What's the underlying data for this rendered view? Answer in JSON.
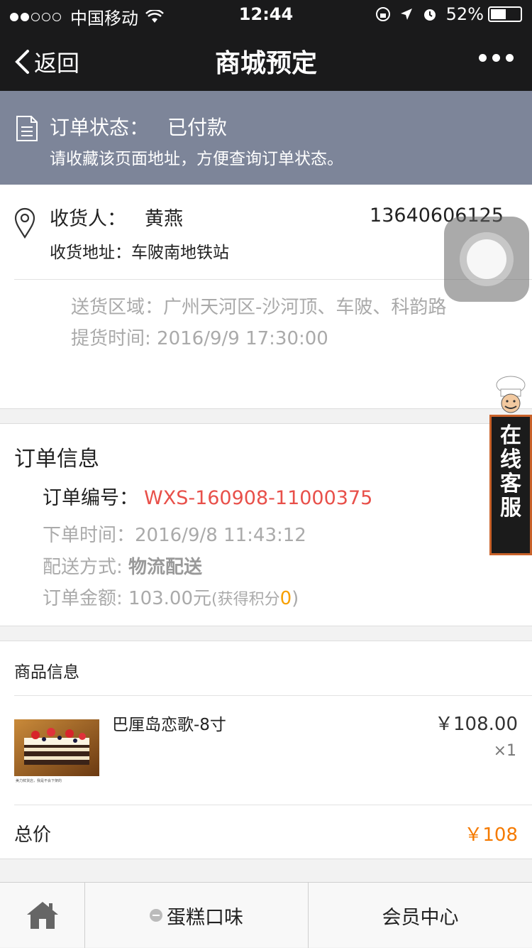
{
  "status_bar": {
    "carrier": "中国移动",
    "time": "12:44",
    "battery": "52%",
    "battery_level": 0.52
  },
  "nav": {
    "back_label": "返回",
    "title": "商城预定"
  },
  "order_status": {
    "label": "订单状态：",
    "value": "已付款",
    "hint": "请收藏该页面地址，方便查询订单状态。"
  },
  "address": {
    "receiver_label": "收货人：",
    "receiver": "黄燕",
    "phone": "13640606125",
    "address_label": "收货地址：",
    "address": "车陂南地铁站",
    "area_label": "送货区域：",
    "area": "广州天河区-沙河顶、车陂、科韵路",
    "pickup_label": "提货时间: ",
    "pickup_time": "2016/9/9 17:30:00"
  },
  "order_info": {
    "title": "订单信息",
    "number_label": "订单编号：",
    "number": "WXS-160908-11000375",
    "time_label": "下单时间：",
    "time": "2016/9/8 11:43:12",
    "delivery_label": "配送方式: ",
    "delivery": "物流配送",
    "amount_label": "订单金额: ",
    "amount": "103.00元",
    "points_prefix": "(获得积分",
    "points": "0",
    "points_suffix": ")"
  },
  "service_float": {
    "chars": [
      "在",
      "线",
      "客",
      "服"
    ]
  },
  "goods": {
    "header": "商品信息",
    "items": [
      {
        "name": "巴厘岛恋歌-8寸",
        "price": "￥108.00",
        "qty": "×1",
        "image_caption": "美力鲜货店，我是不会下架的"
      }
    ],
    "total_label": "总价",
    "total": "￥108"
  },
  "tabbar": {
    "flavor_label": "蛋糕口味",
    "member_label": "会员中心"
  },
  "colors": {
    "bar_bg": "#1a1a1b",
    "banner_bg": "#7d8599",
    "order_no": "#e8504a",
    "total": "#f57a00",
    "points": "#f7a000"
  }
}
